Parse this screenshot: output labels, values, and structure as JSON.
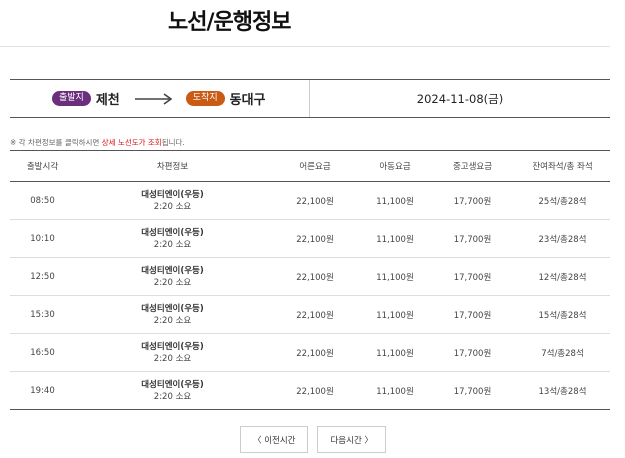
{
  "page": {
    "title": "노선/운행정보"
  },
  "route": {
    "departure_badge": "출발지",
    "departure_city": "제천",
    "arrival_badge": "도착지",
    "arrival_city": "동대구",
    "date": "2024-11-08(금)"
  },
  "notice": {
    "prefix": "※ 각 차편정보를 클릭하시면 ",
    "highlight": "상세 노선도가 조회",
    "suffix": "됩니다."
  },
  "table": {
    "headers": [
      "출발시각",
      "차편정보",
      "어른요금",
      "아동요금",
      "중고생요금",
      "잔여좌석/총 좌석"
    ],
    "rows": [
      {
        "time": "08:50",
        "company": "대성티엔이(우등)",
        "duration": "2:20 소요",
        "adult": "22,100원",
        "child": "11,100원",
        "student": "17,700원",
        "seats": "25석/총28석"
      },
      {
        "time": "10:10",
        "company": "대성티엔이(우등)",
        "duration": "2:20 소요",
        "adult": "22,100원",
        "child": "11,100원",
        "student": "17,700원",
        "seats": "23석/총28석"
      },
      {
        "time": "12:50",
        "company": "대성티엔이(우등)",
        "duration": "2:20 소요",
        "adult": "22,100원",
        "child": "11,100원",
        "student": "17,700원",
        "seats": "12석/총28석"
      },
      {
        "time": "15:30",
        "company": "대성티엔이(우등)",
        "duration": "2:20 소요",
        "adult": "22,100원",
        "child": "11,100원",
        "student": "17,700원",
        "seats": "15석/총28석"
      },
      {
        "time": "16:50",
        "company": "대성티엔이(우등)",
        "duration": "2:20 소요",
        "adult": "22,100원",
        "child": "11,100원",
        "student": "17,700원",
        "seats": "7석/총28석"
      },
      {
        "time": "19:40",
        "company": "대성티엔이(우등)",
        "duration": "2:20 소요",
        "adult": "22,100원",
        "child": "11,100원",
        "student": "17,700원",
        "seats": "13석/총28석"
      }
    ]
  },
  "pager": {
    "prev_label": "〈 이전시간",
    "next_label": "다음시간 〉"
  },
  "colors": {
    "departure_badge": "#6b2f7d",
    "arrival_badge": "#c95b15",
    "highlight": "#dd1111"
  },
  "icons": {
    "route_arrow": "arrow-right-icon"
  }
}
